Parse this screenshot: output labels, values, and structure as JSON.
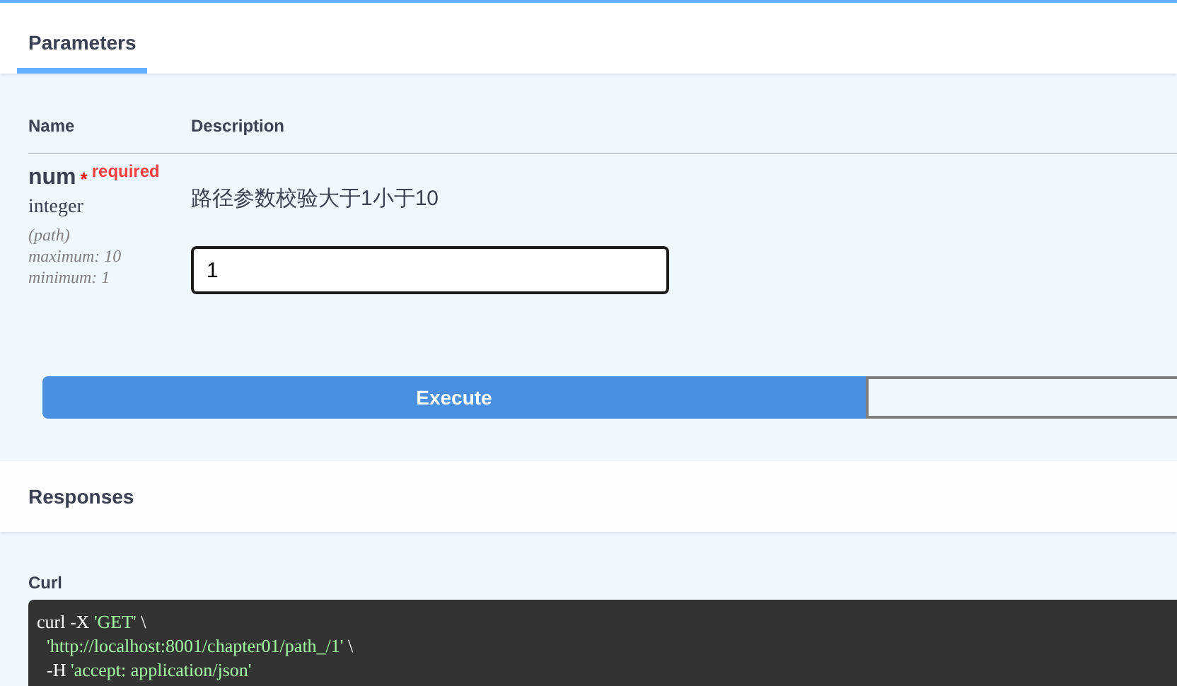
{
  "tabs": [
    {
      "label": "Parameters",
      "selected": true
    }
  ],
  "table": {
    "columns": [
      "Name",
      "Description"
    ],
    "rows": [
      {
        "name": "num",
        "required_mark": "*",
        "required": "required",
        "type": "integer",
        "location": "(path)",
        "constraints": [
          "maximum: 10",
          "minimum: 1"
        ],
        "description": "路径参数校验大于1小于10",
        "value": "1"
      }
    ]
  },
  "execute_button": "Execute",
  "responses": {
    "title": "Responses",
    "curl_label": "Curl",
    "curl_lines": [
      {
        "indent": false,
        "parts": [
          {
            "kind": "plain",
            "text": "curl -X "
          },
          {
            "kind": "string",
            "text": "'GET'"
          },
          {
            "kind": "plain",
            "text": " \\"
          }
        ]
      },
      {
        "indent": true,
        "parts": [
          {
            "kind": "string",
            "text": "'http://localhost:8001/chapter01/path_/1'"
          },
          {
            "kind": "plain",
            "text": " \\"
          }
        ]
      },
      {
        "indent": true,
        "parts": [
          {
            "kind": "plain",
            "text": "-H "
          },
          {
            "kind": "string",
            "text": "'accept: application/json'"
          }
        ]
      }
    ]
  }
}
